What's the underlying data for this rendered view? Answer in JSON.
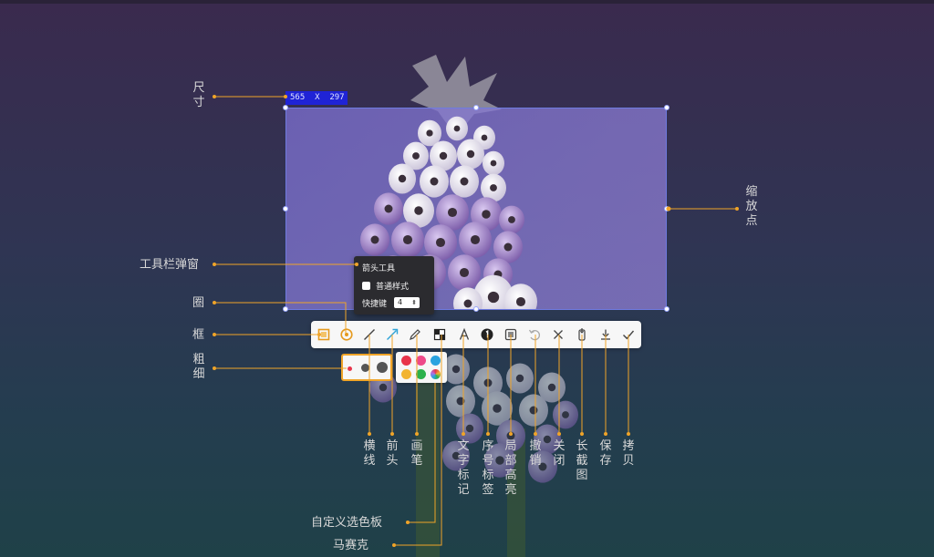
{
  "size_badge": "565  X  297",
  "popup": {
    "title": "箭头工具",
    "checkbox_label": "普通样式",
    "shortcut_label": "快捷键",
    "shortcut_value": "4"
  },
  "annotations": {
    "size": "尺寸",
    "zoom_point": "缩放点",
    "popup": "工具栏弹窗",
    "circle": "圈",
    "box": "框",
    "thickness": "粗细",
    "line": "横线",
    "arrow": "前头",
    "pen": "画笔",
    "text": "文字标记",
    "number": "序号标签",
    "highlight": "局部高亮",
    "undo": "撤销",
    "close": "关闭",
    "long": "长截图",
    "save": "保存",
    "copy": "拷贝",
    "custom_palette": "自定义选色板",
    "mosaic": "马赛克"
  },
  "toolbar": {
    "tools": [
      "rect-icon",
      "circle-icon",
      "line-icon",
      "arrow-icon",
      "pen-icon",
      "mosaic-icon",
      "text-icon",
      "number-icon",
      "highlight-icon",
      "undo-icon",
      "close-icon",
      "long-screenshot-icon",
      "download-icon",
      "check-icon"
    ]
  },
  "colors": {
    "accent": "#f0a428",
    "selection_border": "#6f7be0",
    "badge": "#1f23d6",
    "swatches": [
      "#e8344a",
      "#ee4a8a",
      "#2aa3e0",
      "#f2b431",
      "#2bb24c",
      "#b072e6"
    ]
  }
}
